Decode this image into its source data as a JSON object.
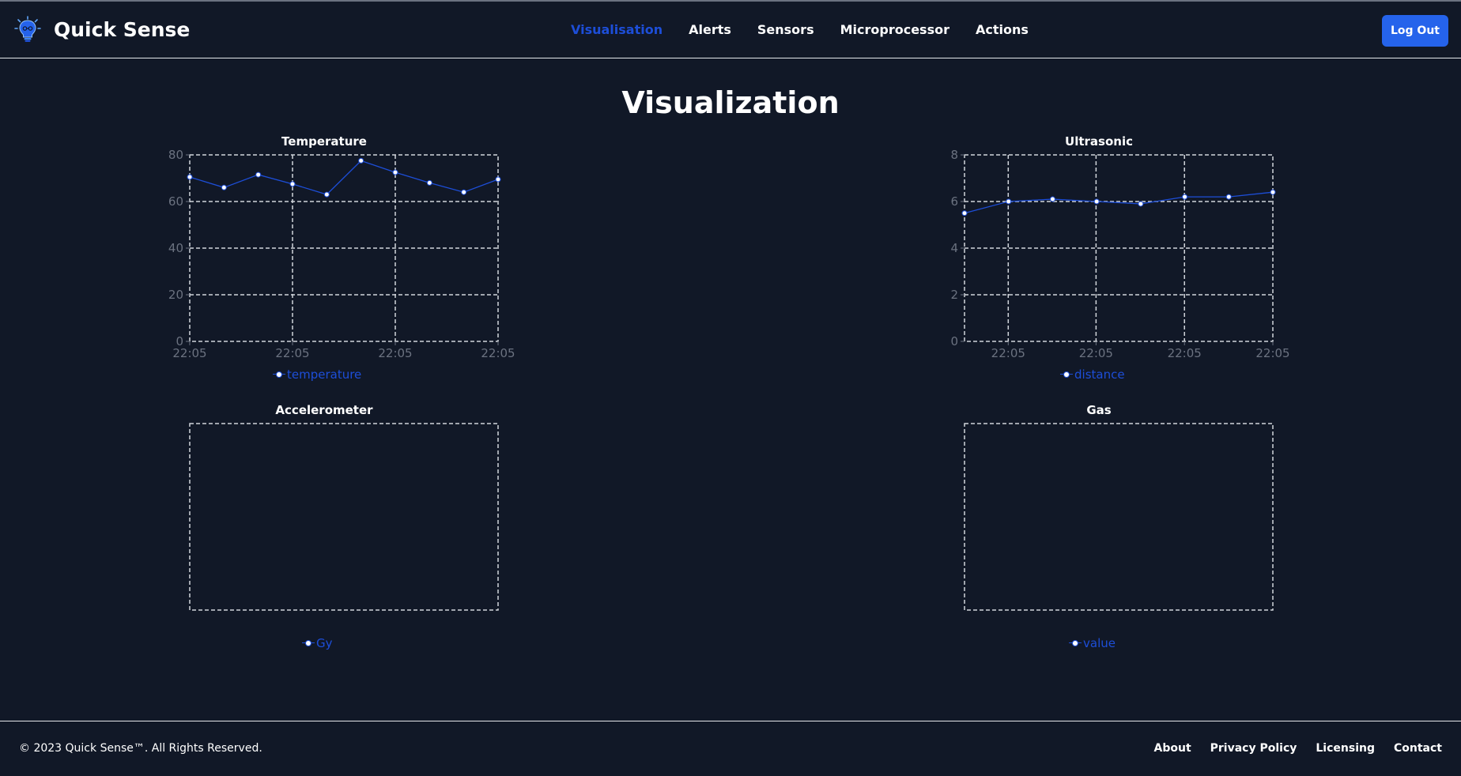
{
  "app": {
    "name": "Quick Sense",
    "logo_icon": "bulb-logo-icon"
  },
  "nav": {
    "items": [
      {
        "label": "Visualisation",
        "active": true
      },
      {
        "label": "Alerts",
        "active": false
      },
      {
        "label": "Sensors",
        "active": false
      },
      {
        "label": "Microprocessor",
        "active": false
      },
      {
        "label": "Actions",
        "active": false
      }
    ]
  },
  "header": {
    "logout_label": "Log Out"
  },
  "page": {
    "title": "Visualization"
  },
  "colors": {
    "background": "#111827",
    "accent": "#1d4ed8",
    "button": "#2563eb",
    "grid": "#d1d5db",
    "tick": "#6b7280"
  },
  "chart_data": [
    {
      "type": "line",
      "title": "Temperature",
      "x": [
        "22:05",
        "22:05",
        "22:05",
        "22:05",
        "22:05",
        "22:05",
        "22:05",
        "22:05",
        "22:05",
        "22:05"
      ],
      "x_tick_labels": [
        "22:05",
        "22:05",
        "22:05",
        "22:05"
      ],
      "series": [
        {
          "name": "temperature",
          "values": [
            70.5,
            66,
            71.5,
            67.5,
            63,
            77.5,
            72.5,
            68,
            64,
            69.5
          ]
        }
      ],
      "ylim": [
        0,
        80
      ],
      "y_ticks": [
        0,
        20,
        40,
        60,
        80
      ],
      "grid": true,
      "legend": "bottom"
    },
    {
      "type": "line",
      "title": "Ultrasonic",
      "x": [
        "22:05",
        "22:05",
        "22:05",
        "22:05",
        "22:05",
        "22:05",
        "22:05",
        "22:05"
      ],
      "x_tick_labels": [
        "22:05",
        "22:05",
        "22:05",
        "22:05",
        "22:05",
        "22:05"
      ],
      "series": [
        {
          "name": "distance",
          "values": [
            5.5,
            6.0,
            6.1,
            6.0,
            5.9,
            6.2,
            6.2,
            6.4
          ]
        }
      ],
      "ylim": [
        0,
        8
      ],
      "y_ticks": [
        0,
        2,
        4,
        6,
        8
      ],
      "grid": true,
      "legend": "bottom"
    },
    {
      "type": "line",
      "title": "Accelerometer",
      "x": [],
      "x_tick_labels": [],
      "series": [
        {
          "name": "Gy",
          "values": []
        }
      ],
      "y_ticks": [],
      "grid": true,
      "legend": "bottom"
    },
    {
      "type": "line",
      "title": "Gas",
      "x": [],
      "x_tick_labels": [],
      "series": [
        {
          "name": "value",
          "values": []
        }
      ],
      "y_ticks": [],
      "grid": true,
      "legend": "bottom"
    }
  ],
  "footer": {
    "copyright": "© 2023 Quick Sense™. All Rights Reserved.",
    "links": [
      "About",
      "Privacy Policy",
      "Licensing",
      "Contact"
    ]
  }
}
